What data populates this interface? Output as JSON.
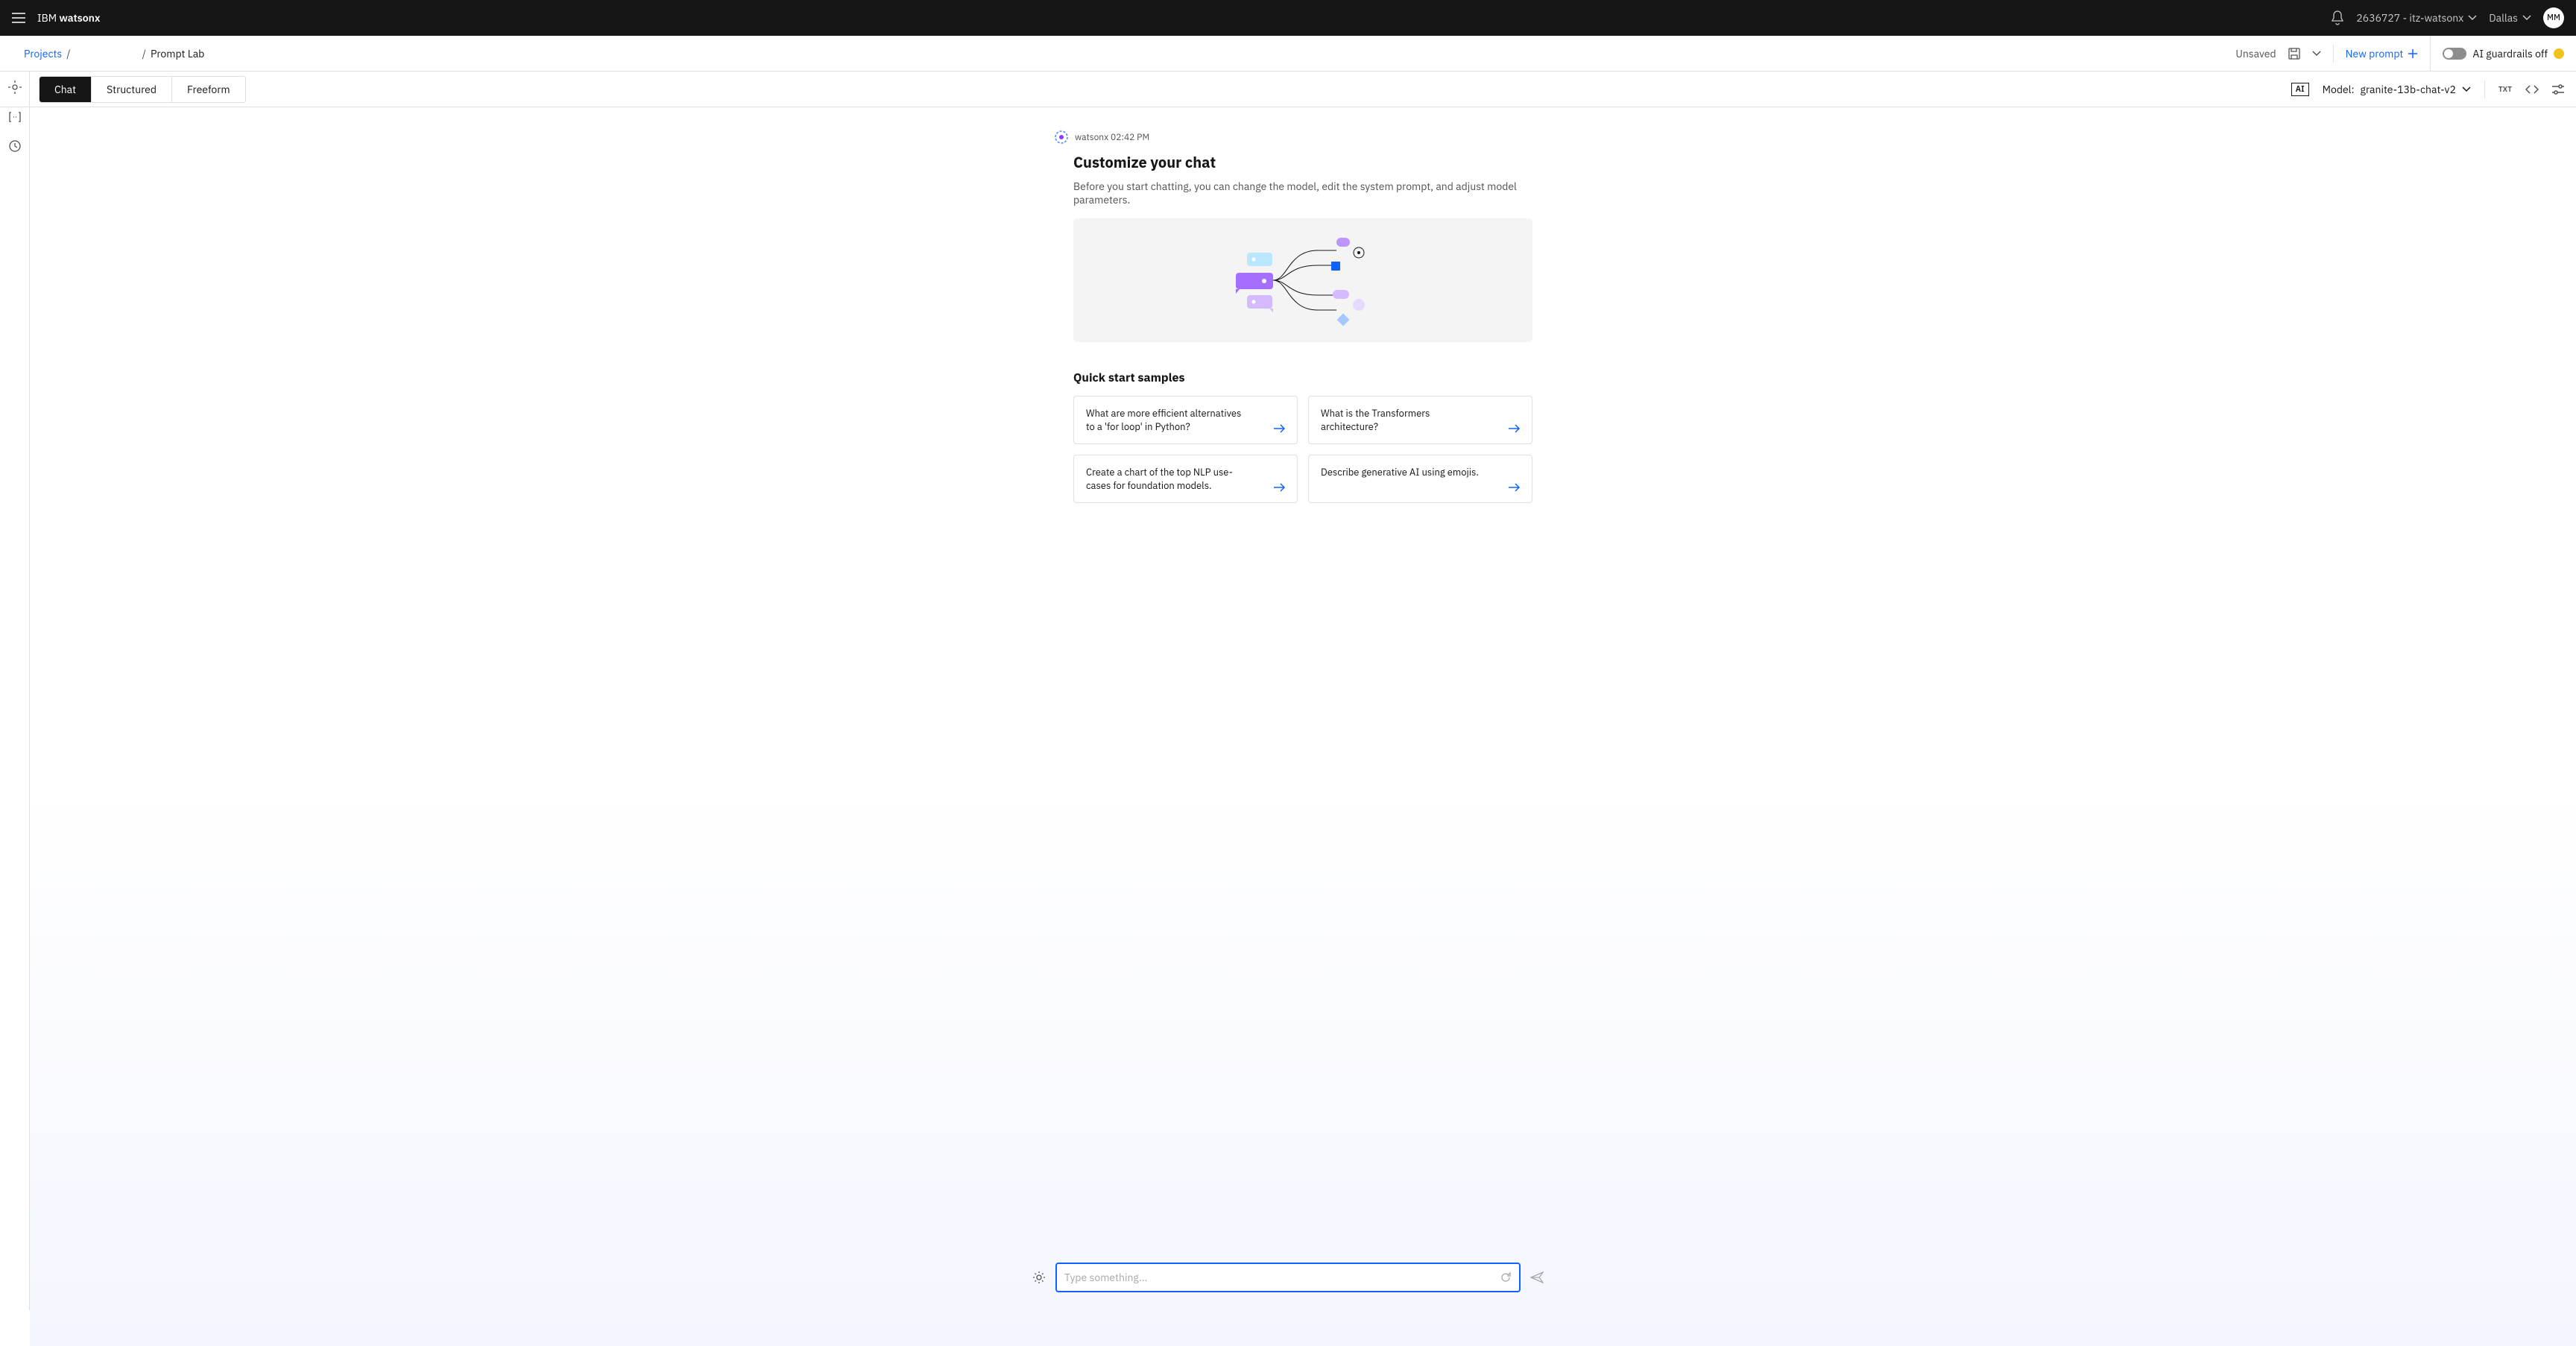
{
  "header": {
    "brand_prefix": "IBM ",
    "brand_bold": "watsonx",
    "account": "2636727 - itz-watsonx",
    "region": "Dallas",
    "avatar_initials": "MM"
  },
  "breadcrumb": {
    "projects": "Projects",
    "current": "Prompt Lab"
  },
  "actions": {
    "unsaved": "Unsaved",
    "new_prompt": "New prompt",
    "guardrails": "AI guardrails off"
  },
  "modes": {
    "chat": "Chat",
    "structured": "Structured",
    "freeform": "Freeform"
  },
  "model": {
    "label_prefix": "Model: ",
    "name": "granite-13b-chat-v2",
    "ai_badge": "AI",
    "txt_label": "TXT"
  },
  "welcome": {
    "bot_name": "watsonx",
    "timestamp": "02:42 PM",
    "title": "Customize your chat",
    "subtitle": "Before you start chatting, you can change the model, edit the system prompt, and adjust model parameters."
  },
  "quickstart": {
    "title": "Quick start samples",
    "items": [
      "What are more efficient alternatives to a 'for loop' in Python?",
      "What is the Transformers architecture?",
      "Create a chart of the top NLP use-cases for foundation models.",
      "Describe generative AI using emojis."
    ]
  },
  "chat_input": {
    "placeholder": "Type something..."
  }
}
